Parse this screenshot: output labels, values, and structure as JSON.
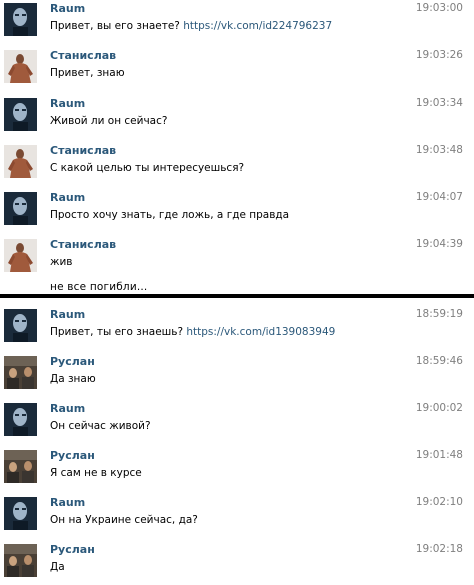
{
  "conversation_1": {
    "messages": [
      {
        "author": "Raum",
        "time": "19:03:00",
        "text": "Привет, вы его знаете?",
        "link": "https://vk.com/id224796237",
        "avatar": "raum-avatar"
      },
      {
        "author": "Станислав",
        "time": "19:03:26",
        "text": "Привет, знаю",
        "avatar": "stanislav-avatar"
      },
      {
        "author": "Raum",
        "time": "19:03:34",
        "text": "Живой ли он сейчас?",
        "avatar": "raum-avatar"
      },
      {
        "author": "Станислав",
        "time": "19:03:48",
        "text": "С какой целью ты интересуешься?",
        "avatar": "stanislav-avatar"
      },
      {
        "author": "Raum",
        "time": "19:04:07",
        "text": "Просто хочу знать, где ложь, а где правда",
        "avatar": "raum-avatar"
      },
      {
        "author": "Станислав",
        "time": "19:04:39",
        "text": "жив",
        "extra": "не все погибли...",
        "avatar": "stanislav-avatar"
      }
    ]
  },
  "conversation_2": {
    "messages": [
      {
        "author": "Raum",
        "time": "18:59:19",
        "text": "Привет, ты его знаешь?",
        "link": "https://vk.com/id139083949",
        "avatar": "raum-avatar"
      },
      {
        "author": "Руслан",
        "time": "18:59:46",
        "text": "Да знаю",
        "avatar": "ruslan-avatar"
      },
      {
        "author": "Raum",
        "time": "19:00:02",
        "text": "Он сейчас живой?",
        "avatar": "raum-avatar"
      },
      {
        "author": "Руслан",
        "time": "19:01:48",
        "text": "Я сам не в курсе",
        "avatar": "ruslan-avatar"
      },
      {
        "author": "Raum",
        "time": "19:02:10",
        "text": "Он на Украине сейчас, да?",
        "avatar": "raum-avatar"
      },
      {
        "author": "Руслан",
        "time": "19:02:18",
        "text": "Да",
        "avatar": "ruslan-avatar"
      }
    ]
  },
  "colors": {
    "author": "#2b587a",
    "link": "#2b587a",
    "time": "#7f7f7f",
    "divider": "#000000"
  }
}
